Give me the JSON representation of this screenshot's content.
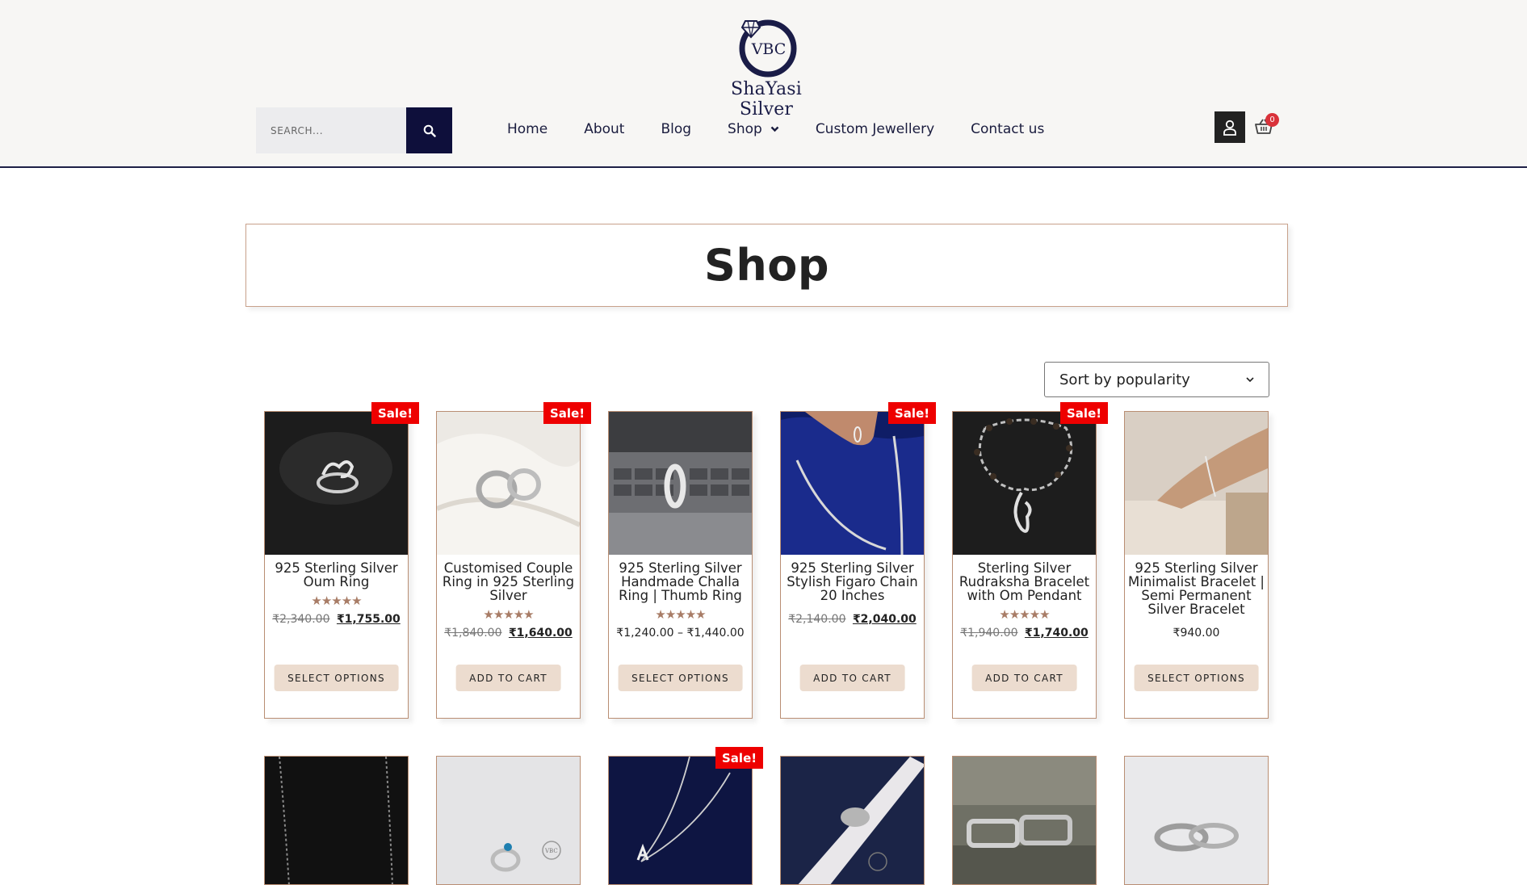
{
  "brand": {
    "logo_initials": "VBC",
    "name": "ShaYasi Silver"
  },
  "search": {
    "placeholder": "SEARCH..."
  },
  "nav": {
    "items": [
      "Home",
      "About",
      "Blog",
      "Shop",
      "Custom Jewellery",
      "Contact us"
    ]
  },
  "cart": {
    "count": "0"
  },
  "page": {
    "title": "Shop"
  },
  "sorting": {
    "selected": "Sort by popularity"
  },
  "products": [
    {
      "name": "925 Sterling Silver Oum Ring",
      "sale": "Sale!",
      "stars": "★★★★★",
      "rating": 5,
      "price_old": "₹2,340.00",
      "price": "₹1,755.00",
      "button": "SELECT OPTIONS"
    },
    {
      "name": "Customised Couple Ring in 925 Sterling Silver",
      "sale": "Sale!",
      "stars": "★★★★★",
      "rating": 5,
      "price_old": "₹1,840.00",
      "price": "₹1,640.00",
      "button": "ADD TO CART"
    },
    {
      "name": "925 Sterling Silver Handmade Challa Ring | Thumb Ring",
      "stars": "★★★★★",
      "rating": 5,
      "price": "₹1,240.00 – ₹1,440.00",
      "button": "SELECT OPTIONS"
    },
    {
      "name": "925 Sterling Silver Stylish Figaro Chain 20 Inches",
      "sale": "Sale!",
      "price_old": "₹2,140.00",
      "price": "₹2,040.00",
      "button": "ADD TO CART"
    },
    {
      "name": "Sterling Silver Rudraksha Bracelet with Om Pendant",
      "sale": "Sale!",
      "stars": "★★★★★",
      "rating": 5,
      "price_old": "₹1,940.00",
      "price": "₹1,740.00",
      "button": "ADD TO CART"
    },
    {
      "name": "925 Sterling Silver Minimalist Bracelet | Semi Permanent Silver Bracelet",
      "price": "₹940.00",
      "button": "SELECT OPTIONS"
    }
  ],
  "products_row2": [
    {
      "sale": ""
    },
    {
      "sale": "",
      "watermark": "ShaYasi Silver"
    },
    {
      "sale": "Sale!"
    },
    {
      "sale": ""
    },
    {
      "sale": ""
    },
    {
      "sale": ""
    }
  ],
  "colors": {
    "navy": "#0e0f3b",
    "sale_red": "#ee0000",
    "button_beige": "#ecdccf",
    "border_brown": "#b98e73",
    "header_bg": "#f7f6f4"
  },
  "icons": {
    "search": "search-icon",
    "account": "user-icon",
    "cart": "basket-icon",
    "dropdown": "chevron-down-icon"
  }
}
